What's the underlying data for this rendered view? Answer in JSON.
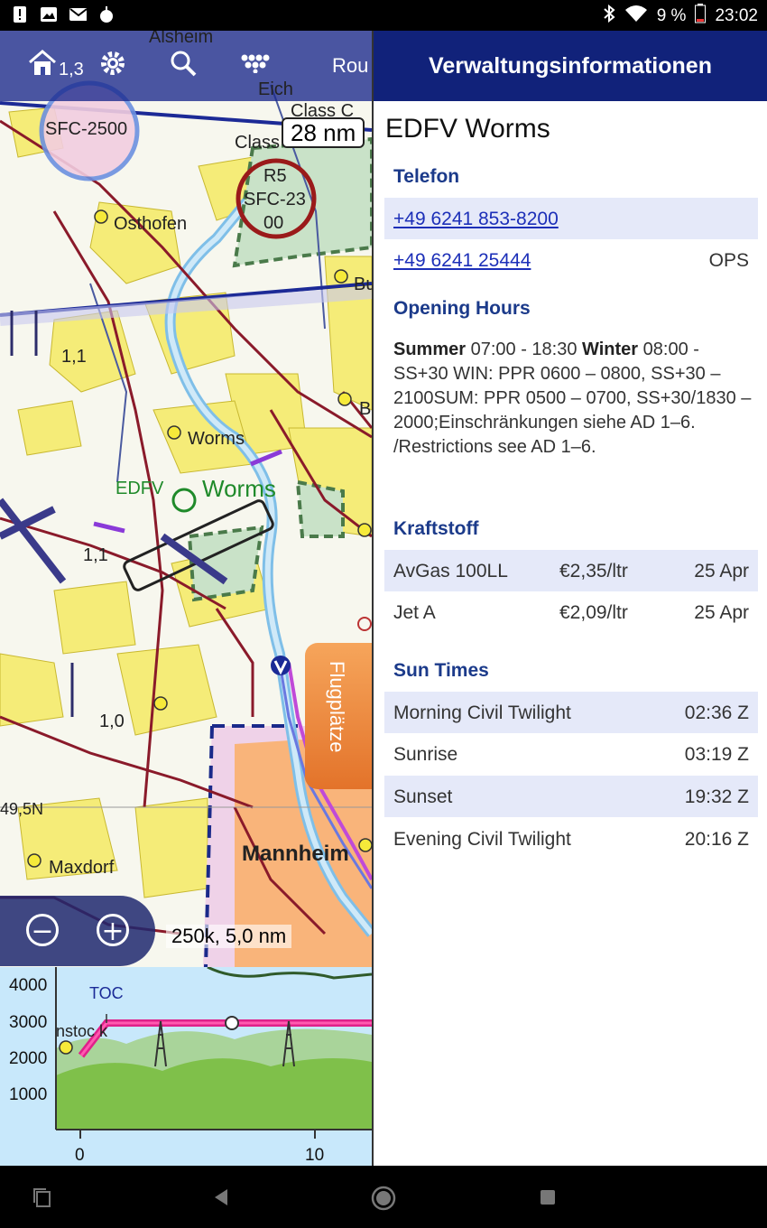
{
  "status_bar": {
    "battery": "9 %",
    "time": "23:02"
  },
  "map": {
    "toolbar": {
      "route_label": "Rou"
    },
    "scale_distance": "28 nm",
    "scale_ruler": "250k, 5,0 nm",
    "flugplaetze_tab": "Flugplätze",
    "labels": {
      "alsheim": "Alsheim",
      "eich": "Eich",
      "osthofen": "Osthofen",
      "worms_town": "Worms",
      "edfv": "EDFV",
      "worms_airport": "Worms",
      "mannheim": "Mannheim",
      "maxdorf": "Maxdorf",
      "class_c": "Class C",
      "class": "Class",
      "sfc2500": "SFC-2500",
      "r5_a": "R5",
      "r5_b": "SFC-23",
      "r5_c": "00",
      "lat": "49,5N",
      "v11a": "1,1",
      "v11b": "1,1",
      "v10": "1,0",
      "v13": "1,3",
      "bu": "Bu",
      "b": "B"
    }
  },
  "profile": {
    "y_labels": [
      "4000",
      "3000",
      "2000",
      "1000"
    ],
    "x_labels": [
      "0",
      "10"
    ],
    "toc_label": "TOC",
    "start_label": "nstoc k"
  },
  "panel": {
    "header": "Verwaltungsinformationen",
    "airport": "EDFV Worms",
    "telefon": {
      "heading": "Telefon",
      "numbers": [
        {
          "number": "+49 6241 853-8200",
          "note": ""
        },
        {
          "number": "+49 6241 25444",
          "note": "OPS"
        }
      ]
    },
    "opening_hours": {
      "heading": "Opening Hours",
      "summer_label": "Summer",
      "summer_time": "07:00 - 18:30",
      "winter_label": "Winter",
      "details": "08:00 - SS+30 WIN: PPR 0600 – 0800, SS+30 – 2100SUM: PPR 0500 – 0700, SS+30/1830 – 2000;Einschränkungen siehe AD 1–6. /Restrictions see AD 1–6."
    },
    "fuel": {
      "heading": "Kraftstoff",
      "rows": [
        {
          "type": "AvGas 100LL",
          "price": "€2,35/ltr",
          "date": "25 Apr"
        },
        {
          "type": "Jet A",
          "price": "€2,09/ltr",
          "date": "25 Apr"
        }
      ]
    },
    "sun_times": {
      "heading": "Sun Times",
      "rows": [
        {
          "label": "Morning Civil Twilight",
          "time": "02:36 Z"
        },
        {
          "label": "Sunrise",
          "time": "03:19 Z"
        },
        {
          "label": "Sunset",
          "time": "19:32 Z"
        },
        {
          "label": "Evening Civil Twilight",
          "time": "20:16 Z"
        }
      ]
    }
  }
}
